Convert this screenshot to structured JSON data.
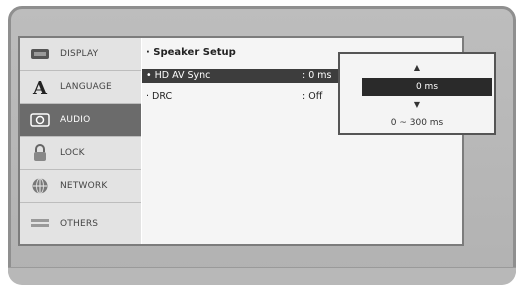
{
  "sidebar": {
    "items": [
      {
        "label": "DISPLAY",
        "icon": "display-icon",
        "active": false
      },
      {
        "label": "LANGUAGE",
        "icon": "language-a-icon",
        "active": false
      },
      {
        "label": "AUDIO",
        "icon": "audio-speaker-icon",
        "active": true
      },
      {
        "label": "LOCK",
        "icon": "lock-icon",
        "active": false
      },
      {
        "label": "NETWORK",
        "icon": "network-globe-icon",
        "active": false
      },
      {
        "label": "OTHERS",
        "icon": "others-icon",
        "active": false
      }
    ]
  },
  "menu": {
    "title": "· Speaker Setup",
    "rows": [
      {
        "label": "• HD AV Sync",
        "value": ": 0 ms",
        "active": true
      },
      {
        "label": "· DRC",
        "value": ": Off",
        "active": false
      }
    ]
  },
  "popup": {
    "value": "0 ms",
    "range": "0 ~ 300 ms",
    "up_arrow": "▲",
    "down_arrow": "▼"
  },
  "colors": {
    "active_bg": "#6b6b6b",
    "highlight_bg": "#3d3d3d",
    "frame": "#b8b8b8"
  }
}
